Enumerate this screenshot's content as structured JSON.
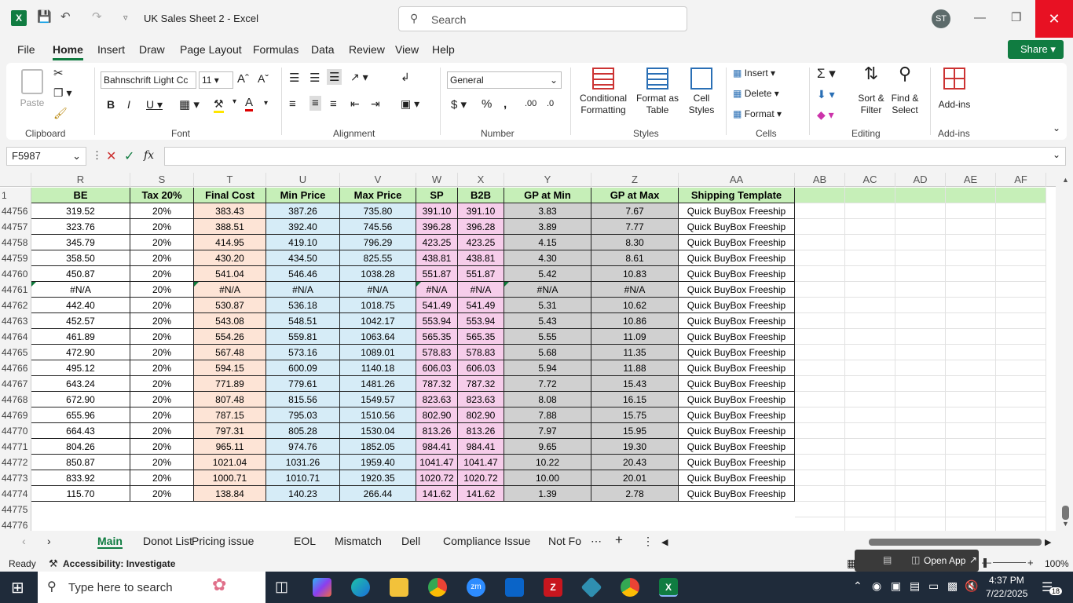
{
  "titlebar": {
    "doc_title": "UK Sales Sheet 2  -  Excel",
    "search_placeholder": "Search",
    "avatar": "ST"
  },
  "menu": {
    "tabs": [
      "File",
      "Home",
      "Insert",
      "Draw",
      "Page Layout",
      "Formulas",
      "Data",
      "Review",
      "View",
      "Help"
    ],
    "share": "Share"
  },
  "ribbon": {
    "clipboard": {
      "paste": "Paste",
      "group": "Clipboard"
    },
    "font": {
      "name": "Bahnschrift Light Cc",
      "size": "11",
      "group": "Font"
    },
    "alignment": {
      "group": "Alignment"
    },
    "number": {
      "format": "General",
      "group": "Number"
    },
    "styles": {
      "conditional": "Conditional\nFormatting",
      "format_table": "Format as\nTable",
      "cell_styles": "Cell\nStyles",
      "group": "Styles"
    },
    "cells": {
      "insert": "Insert",
      "delete": "Delete",
      "format": "Format",
      "group": "Cells"
    },
    "editing": {
      "sort": "Sort &\nFilter",
      "find": "Find &\nSelect",
      "group": "Editing"
    },
    "addins": {
      "label": "Add-ins",
      "group": "Add-ins"
    }
  },
  "formula": {
    "namebox": "F5987",
    "value": ""
  },
  "columns": [
    "R",
    "S",
    "T",
    "U",
    "V",
    "W",
    "X",
    "Y",
    "Z",
    "AA",
    "AB",
    "AC",
    "AD",
    "AE",
    "AF"
  ],
  "header_row": {
    "row": "1",
    "cells": [
      "BE",
      "Tax 20%",
      "Final Cost",
      "Min Price",
      "Max Price",
      "SP",
      "B2B",
      "GP at Min",
      "GP at Max",
      "Shipping Template"
    ]
  },
  "rows": [
    {
      "n": "44756",
      "c": [
        "319.52",
        "20%",
        "383.43",
        "387.26",
        "735.80",
        "391.10",
        "391.10",
        "3.83",
        "7.67",
        "Quick BuyBox Freeship"
      ]
    },
    {
      "n": "44757",
      "c": [
        "323.76",
        "20%",
        "388.51",
        "392.40",
        "745.56",
        "396.28",
        "396.28",
        "3.89",
        "7.77",
        "Quick BuyBox Freeship"
      ]
    },
    {
      "n": "44758",
      "c": [
        "345.79",
        "20%",
        "414.95",
        "419.10",
        "796.29",
        "423.25",
        "423.25",
        "4.15",
        "8.30",
        "Quick BuyBox Freeship"
      ]
    },
    {
      "n": "44759",
      "c": [
        "358.50",
        "20%",
        "430.20",
        "434.50",
        "825.55",
        "438.81",
        "438.81",
        "4.30",
        "8.61",
        "Quick BuyBox Freeship"
      ]
    },
    {
      "n": "44760",
      "c": [
        "450.87",
        "20%",
        "541.04",
        "546.46",
        "1038.28",
        "551.87",
        "551.87",
        "5.42",
        "10.83",
        "Quick BuyBox Freeship"
      ]
    },
    {
      "n": "44761",
      "c": [
        "#N/A",
        "20%",
        "#N/A",
        "#N/A",
        "#N/A",
        "#N/A",
        "#N/A",
        "#N/A",
        "#N/A",
        "Quick BuyBox Freeship"
      ],
      "na": true
    },
    {
      "n": "44762",
      "c": [
        "442.40",
        "20%",
        "530.87",
        "536.18",
        "1018.75",
        "541.49",
        "541.49",
        "5.31",
        "10.62",
        "Quick BuyBox Freeship"
      ]
    },
    {
      "n": "44763",
      "c": [
        "452.57",
        "20%",
        "543.08",
        "548.51",
        "1042.17",
        "553.94",
        "553.94",
        "5.43",
        "10.86",
        "Quick BuyBox Freeship"
      ]
    },
    {
      "n": "44764",
      "c": [
        "461.89",
        "20%",
        "554.26",
        "559.81",
        "1063.64",
        "565.35",
        "565.35",
        "5.55",
        "11.09",
        "Quick BuyBox Freeship"
      ]
    },
    {
      "n": "44765",
      "c": [
        "472.90",
        "20%",
        "567.48",
        "573.16",
        "1089.01",
        "578.83",
        "578.83",
        "5.68",
        "11.35",
        "Quick BuyBox Freeship"
      ]
    },
    {
      "n": "44766",
      "c": [
        "495.12",
        "20%",
        "594.15",
        "600.09",
        "1140.18",
        "606.03",
        "606.03",
        "5.94",
        "11.88",
        "Quick BuyBox Freeship"
      ]
    },
    {
      "n": "44767",
      "c": [
        "643.24",
        "20%",
        "771.89",
        "779.61",
        "1481.26",
        "787.32",
        "787.32",
        "7.72",
        "15.43",
        "Quick BuyBox Freeship"
      ]
    },
    {
      "n": "44768",
      "c": [
        "672.90",
        "20%",
        "807.48",
        "815.56",
        "1549.57",
        "823.63",
        "823.63",
        "8.08",
        "16.15",
        "Quick BuyBox Freeship"
      ]
    },
    {
      "n": "44769",
      "c": [
        "655.96",
        "20%",
        "787.15",
        "795.03",
        "1510.56",
        "802.90",
        "802.90",
        "7.88",
        "15.75",
        "Quick BuyBox Freeship"
      ]
    },
    {
      "n": "44770",
      "c": [
        "664.43",
        "20%",
        "797.31",
        "805.28",
        "1530.04",
        "813.26",
        "813.26",
        "7.97",
        "15.95",
        "Quick BuyBox Freeship"
      ]
    },
    {
      "n": "44771",
      "c": [
        "804.26",
        "20%",
        "965.11",
        "974.76",
        "1852.05",
        "984.41",
        "984.41",
        "9.65",
        "19.30",
        "Quick BuyBox Freeship"
      ]
    },
    {
      "n": "44772",
      "c": [
        "850.87",
        "20%",
        "1021.04",
        "1031.26",
        "1959.40",
        "1041.47",
        "1041.47",
        "10.22",
        "20.43",
        "Quick BuyBox Freeship"
      ]
    },
    {
      "n": "44773",
      "c": [
        "833.92",
        "20%",
        "1000.71",
        "1010.71",
        "1920.35",
        "1020.72",
        "1020.72",
        "10.00",
        "20.01",
        "Quick BuyBox Freeship"
      ]
    },
    {
      "n": "44774",
      "c": [
        "115.70",
        "20%",
        "138.84",
        "140.23",
        "266.44",
        "141.62",
        "141.62",
        "1.39",
        "2.78",
        "Quick BuyBox Freeship"
      ]
    }
  ],
  "empty_rows": [
    "44775",
    "44776"
  ],
  "fills": [
    "#ffffff",
    "#ffffff",
    "#fde4d6",
    "#d6ecf7",
    "#d6ecf7",
    "#f6cdea",
    "#f6cdea",
    "#d0d0d0",
    "#d0d0d0",
    "#ffffff"
  ],
  "sheets": [
    "Main",
    "Donot List",
    "Pricing issue",
    "EOL",
    "Mismatch",
    "Dell",
    "Compliance Issue",
    "Not Fo"
  ],
  "status": {
    "ready": "Ready",
    "accessibility": "Accessibility: Investigate",
    "open_app": "Open App",
    "zoom": "100%"
  },
  "taskbar": {
    "search": "Type here to search",
    "time": "4:37 PM",
    "date": "7/22/2025",
    "notifications": "18"
  }
}
